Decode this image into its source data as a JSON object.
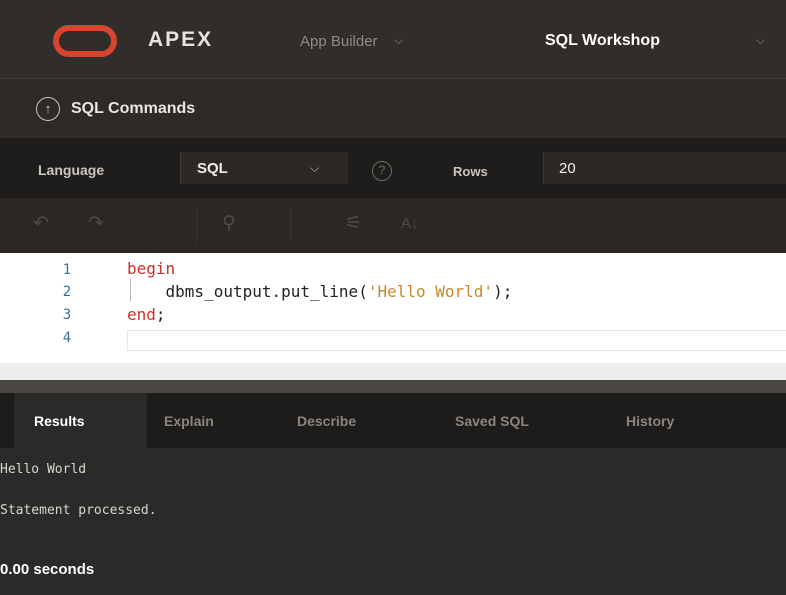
{
  "header": {
    "brand": "APEX",
    "nav": [
      {
        "label": "App Builder",
        "chevron": "⌵"
      },
      {
        "label": "SQL Workshop",
        "chevron": "⌵"
      }
    ],
    "logo_color": "#d8452f"
  },
  "breadcrumb": {
    "up_icon": "↑",
    "title": "SQL Commands"
  },
  "options": {
    "language_label": "Language",
    "language_value": "SQL",
    "language_chevron": "⌵",
    "help_icon": "?",
    "rows_label": "Rows",
    "rows_value": "20"
  },
  "toolbar": {
    "undo_icon": "↶",
    "redo_icon": "↷",
    "find_icon": "⚲",
    "autocomplete_icon": "⚟",
    "format_label": "A↓"
  },
  "editor": {
    "line_numbers": [
      "1",
      "2",
      "3",
      "4"
    ],
    "lines": {
      "l1_kw": "begin",
      "l2_pre": "    dbms_output.put_line(",
      "l2_str": "'Hello World'",
      "l2_post": ");",
      "l3_kw": "end",
      "l3_post": ";"
    }
  },
  "results": {
    "tabs": [
      "Results",
      "Explain",
      "Describe",
      "Saved SQL",
      "History"
    ],
    "active_tab": "Results",
    "output_lines": [
      "Hello World",
      "Statement processed."
    ],
    "elapsed": "0.00 seconds"
  }
}
